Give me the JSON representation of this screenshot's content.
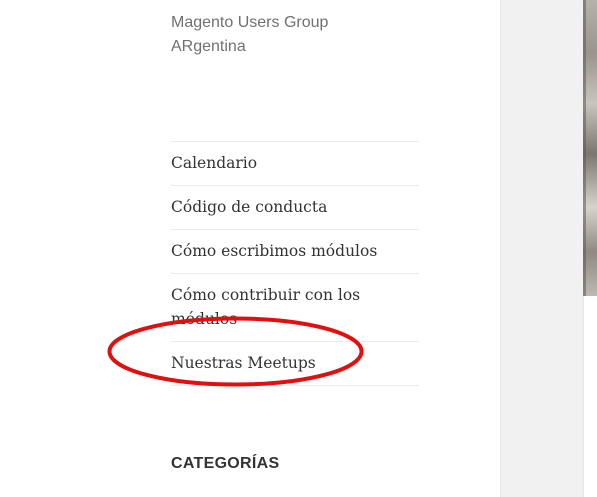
{
  "site": {
    "description": "Magento Users Group ARgentina"
  },
  "menu": {
    "items": [
      {
        "label": "Calendario"
      },
      {
        "label": "Código de conducta"
      },
      {
        "label": "Cómo escribimos módulos"
      },
      {
        "label": "Cómo contribuir con los módulos"
      },
      {
        "label": "Nuestras Meetups"
      }
    ]
  },
  "widgets": {
    "categories_title": "CATEGORÍAS"
  },
  "annotation": {
    "color": "#e01010",
    "highlighted_item": "Nuestras Meetups"
  },
  "colors": {
    "sidebar_bg": "#ffffff",
    "page_bg": "#f1f1f1",
    "text": "#333333",
    "muted_text": "#707070",
    "divider": "#eaeaea"
  }
}
